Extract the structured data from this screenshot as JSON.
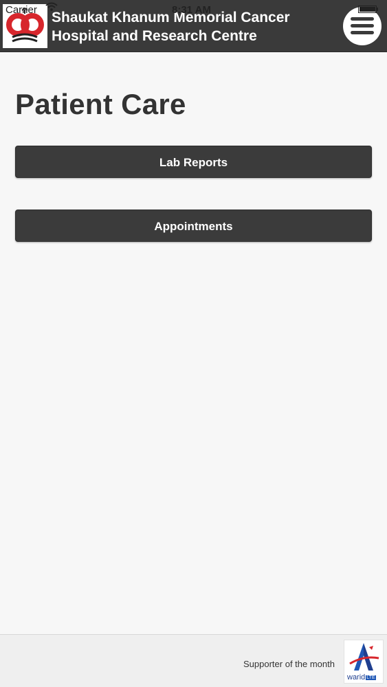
{
  "status_bar": {
    "carrier": "Carrier",
    "time": "8:31 AM"
  },
  "header": {
    "title_line1": "Shaukat Khanum Memorial Cancer",
    "title_line2": "Hospital and Research Centre",
    "logo_icon": "skmch-logo-icon",
    "menu_icon": "hamburger-menu-icon"
  },
  "main": {
    "title": "Patient Care",
    "buttons": [
      {
        "label": "Lab Reports"
      },
      {
        "label": "Appointments"
      }
    ]
  },
  "footer": {
    "supporter_text": "Supporter of the month",
    "sponsor_name": "warid",
    "sponsor_badge": "LTE"
  },
  "colors": {
    "header_bg": "#3a3a3a",
    "button_bg": "#3b3b3b",
    "page_bg": "#f7f7f7",
    "logo_red": "#d7262c",
    "sponsor_blue": "#1f57b5"
  }
}
